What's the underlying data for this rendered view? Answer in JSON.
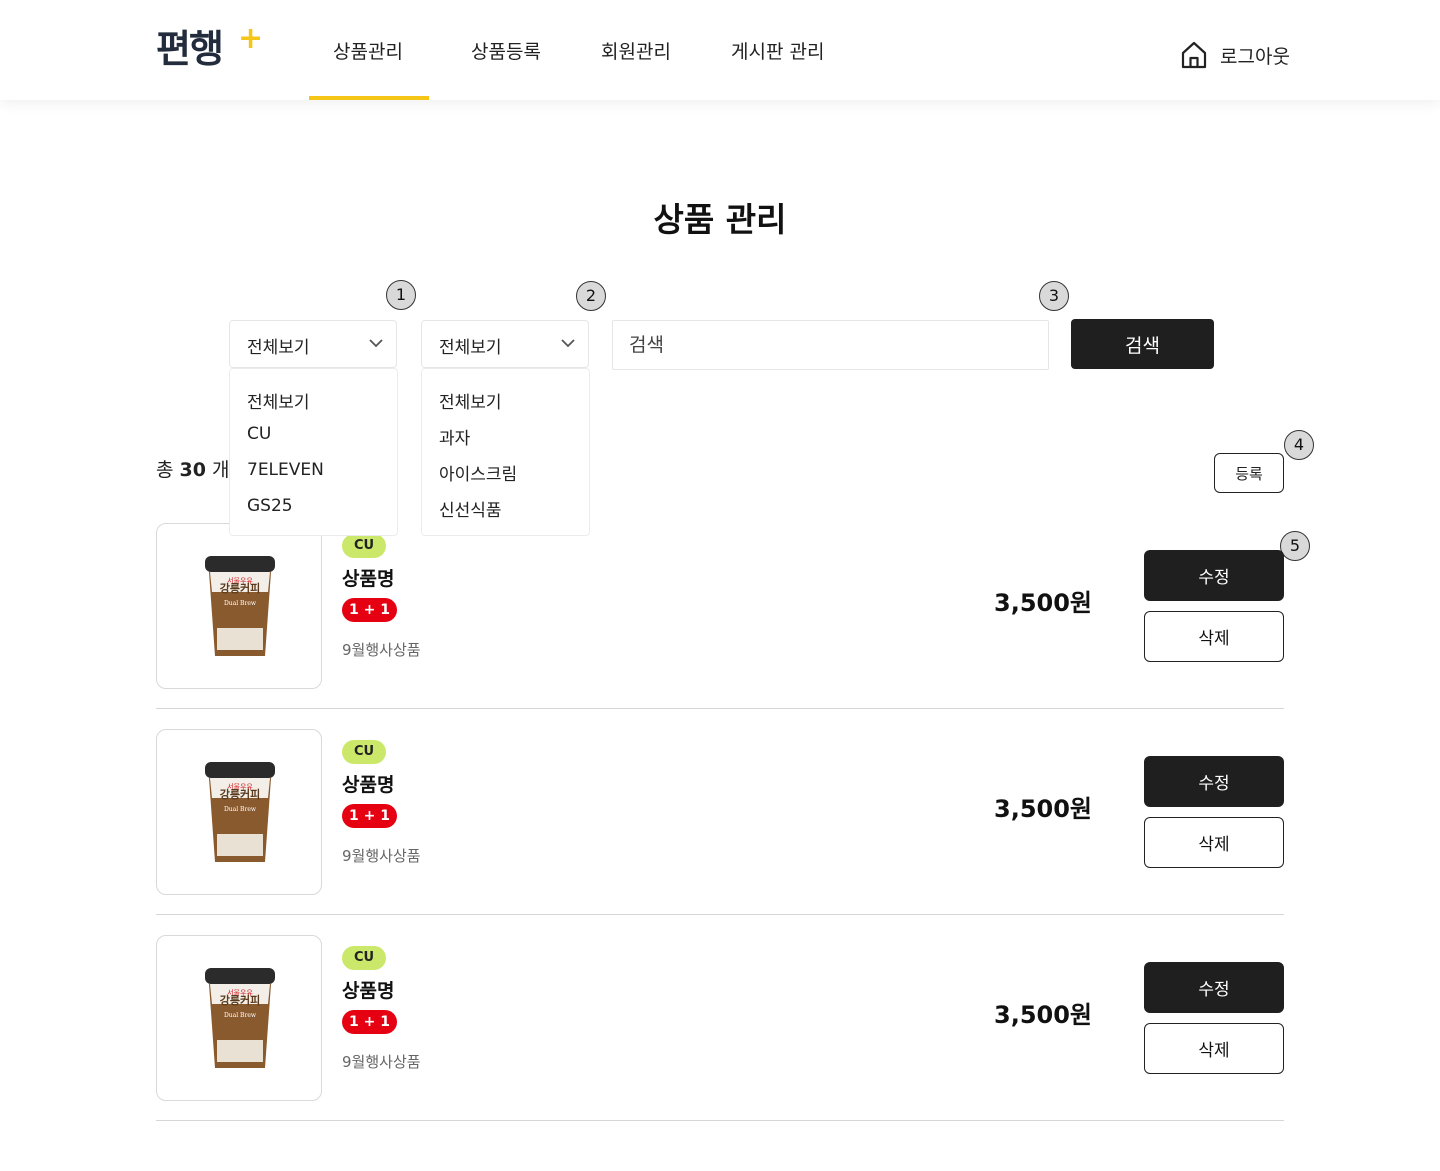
{
  "header": {
    "logo": "편행",
    "logo_plus": "+",
    "nav": [
      {
        "label": "상품관리",
        "active": true
      },
      {
        "label": "상품등록",
        "active": false
      },
      {
        "label": "회원관리",
        "active": false
      },
      {
        "label": "게시판 관리",
        "active": false
      }
    ],
    "logout_label": "로그아웃",
    "accent_color": "#f5c518"
  },
  "page_title": "상품 관리",
  "markers": [
    "1",
    "2",
    "3",
    "4",
    "5"
  ],
  "filters": {
    "store_select": {
      "value": "전체보기",
      "options": [
        "전체보기",
        "CU",
        "7ELEVEN",
        "GS25"
      ]
    },
    "category_select": {
      "value": "전체보기",
      "options": [
        "전체보기",
        "과자",
        "아이스크림",
        "신선식품"
      ]
    },
    "search": {
      "placeholder": "검색",
      "value": ""
    },
    "search_button": "검색"
  },
  "summary": {
    "prefix": "총",
    "count": "30",
    "suffix": "개"
  },
  "register_button": "등록",
  "products": [
    {
      "store": "CU",
      "name": "상품명",
      "promo": "1 + 1",
      "event": "9월행사상품",
      "price": "3,500원",
      "edit": "수정",
      "delete": "삭제",
      "product_label": "강릉커피",
      "product_sublabel": "Dual Brew",
      "brand": "서울우유"
    },
    {
      "store": "CU",
      "name": "상품명",
      "promo": "1 + 1",
      "event": "9월행사상품",
      "price": "3,500원",
      "edit": "수정",
      "delete": "삭제",
      "product_label": "강릉커피",
      "product_sublabel": "Dual Brew",
      "brand": "서울우유"
    },
    {
      "store": "CU",
      "name": "상품명",
      "promo": "1 + 1",
      "event": "9월행사상품",
      "price": "3,500원",
      "edit": "수정",
      "delete": "삭제",
      "product_label": "강릉커피",
      "product_sublabel": "Dual Brew",
      "brand": "서울우유"
    }
  ],
  "colors": {
    "dark_button": "#1f1f1f",
    "store_badge": "#cbe86b",
    "promo_badge": "#e50012"
  }
}
